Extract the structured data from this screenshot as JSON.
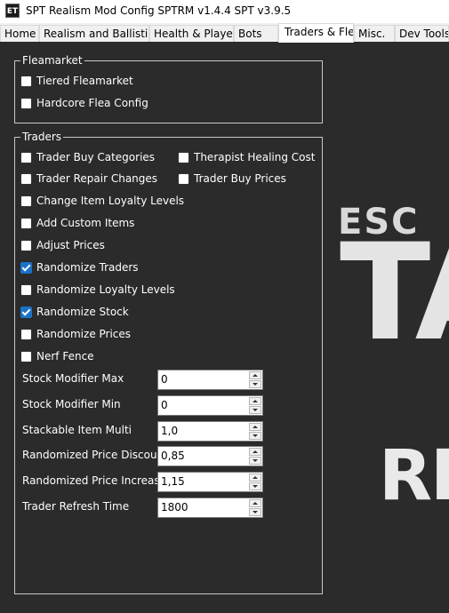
{
  "window": {
    "icon_text": "ET",
    "title": "SPT Realism Mod Config SPTRM v1.4.4 SPT v3.9.5"
  },
  "tabs": [
    {
      "label": "Home",
      "active": false
    },
    {
      "label": "Realism and Ballistics",
      "active": false
    },
    {
      "label": "Health & Player",
      "active": false
    },
    {
      "label": "Bots",
      "active": false
    },
    {
      "label": "Traders & Flea",
      "active": true
    },
    {
      "label": "Misc.",
      "active": false
    },
    {
      "label": "Dev Tools",
      "active": false
    }
  ],
  "fleamarket": {
    "legend": "Fleamarket",
    "options": [
      {
        "label": "Tiered Fleamarket",
        "checked": false
      },
      {
        "label": "Hardcore Flea Config",
        "checked": false
      }
    ]
  },
  "traders": {
    "legend": "Traders",
    "options": [
      {
        "label": "Trader Buy Categories",
        "checked": false
      },
      {
        "label": "Therapist Healing Cost",
        "checked": false
      },
      {
        "label": "Trader Repair Changes",
        "checked": false
      },
      {
        "label": "Trader Buy Prices",
        "checked": false
      },
      {
        "label": "Change Item Loyalty Levels",
        "checked": false
      },
      {
        "label": "Add Custom Items",
        "checked": false
      },
      {
        "label": "Adjust Prices",
        "checked": false
      },
      {
        "label": "Randomize Traders",
        "checked": true
      },
      {
        "label": "Randomize Loyalty Levels",
        "checked": false
      },
      {
        "label": "Randomize Stock",
        "checked": true
      },
      {
        "label": "Randomize Prices",
        "checked": false
      },
      {
        "label": "Nerf Fence",
        "checked": false
      }
    ],
    "numeric": [
      {
        "label": "Stock Modifier Max",
        "value": "0"
      },
      {
        "label": "Stock Modifier Min",
        "value": "0"
      },
      {
        "label": "Stackable Item Multi",
        "value": "1,0"
      },
      {
        "label": "Randomized Price Discount",
        "value": "0,85"
      },
      {
        "label": "Randomized Price Increase",
        "value": "1,15"
      },
      {
        "label": "Trader Refresh Time",
        "value": "1800"
      }
    ]
  },
  "background_art": {
    "line1": "ESC",
    "line2": "TA",
    "line3": "RE"
  },
  "colors": {
    "panel_bg": "#2b2b2b",
    "check_accent": "#1a73c7",
    "tab_strip": "#f0f0f0"
  }
}
